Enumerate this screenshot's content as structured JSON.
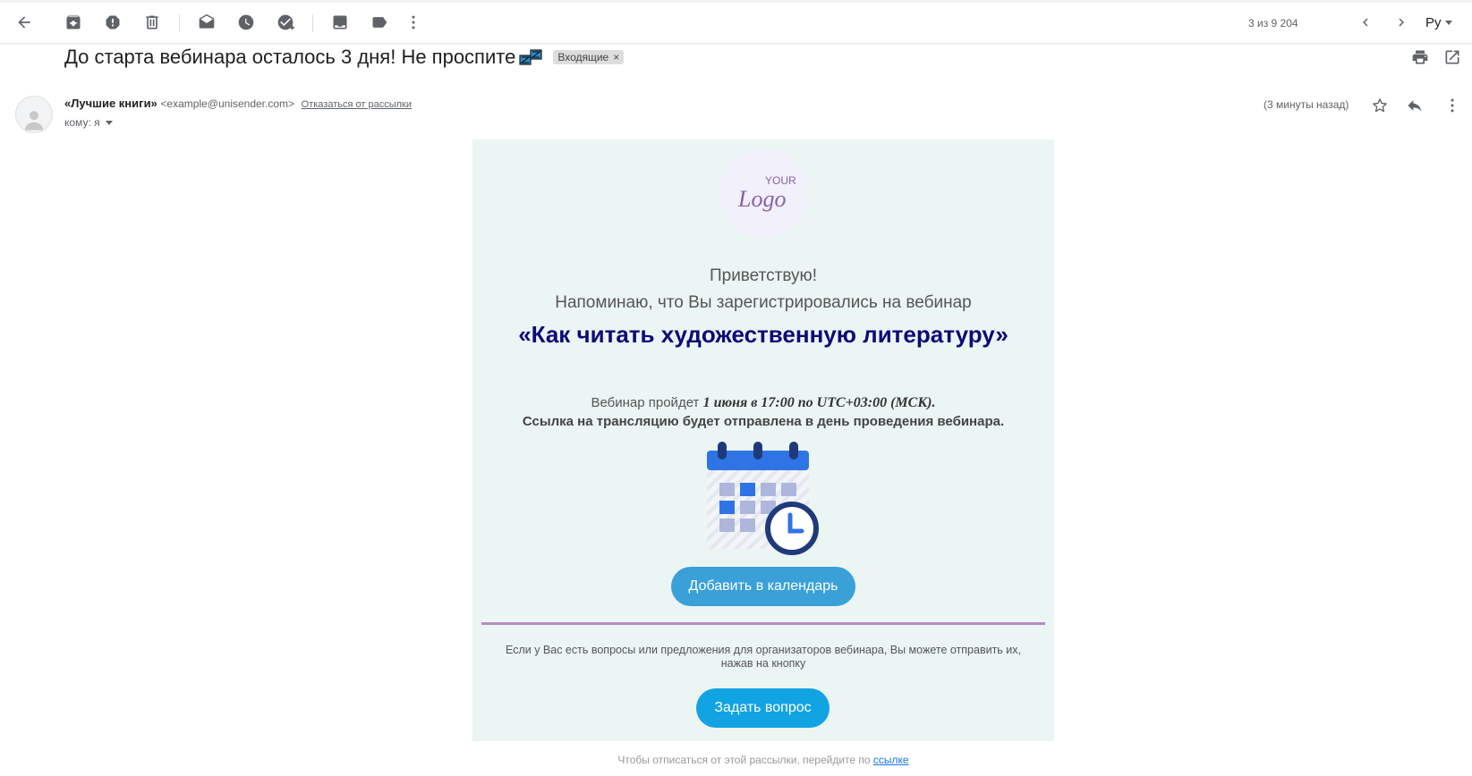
{
  "toolbar": {
    "back_icon": "arrow-left-icon",
    "pager": "3 из 9 204",
    "lang": "Ру"
  },
  "subject": {
    "text": "До старта вебинара осталось 3 дня! Не проспите",
    "emoji": "zzz-emoji",
    "label": "Входящие",
    "label_close": "×"
  },
  "message": {
    "sender_name": "«Лучшие книги»",
    "sender_email": "<example@unisender.com>",
    "unsubscribe": "Отказаться от рассылки",
    "to": "кому: я",
    "time": "(3 минуты назад)"
  },
  "email": {
    "logo_top": "YOUR",
    "logo_bottom": "Logo",
    "greeting": "Приветствую!",
    "reminder": "Напоминаю, что Вы зарегистрировались на вебинар",
    "title": "«Как читать художественную литературу»",
    "when_prefix": "Вебинар пройдет",
    "when_value": "1 июня в 17:00 по UTC+03:00 (МСК).",
    "link_note": "Ссылка на трансляцию будет отправлена в день проведения вебинара.",
    "add_calendar": "Добавить в календарь",
    "question_note": "Если у Вас есть вопросы или предложения для организаторов вебинара, Вы можете отправить их, нажав на кнопку",
    "ask_button": "Задать вопрос",
    "footer_text": "Чтобы отписаться от этой рассылки, перейдите по",
    "footer_link": "ссылке"
  },
  "colors": {
    "email_bg": "#ebf5f4",
    "title": "#0b0b78",
    "calendar_button": "#3aa0d8",
    "ask_button": "#12a3e3",
    "divider": "#b98ac4"
  }
}
